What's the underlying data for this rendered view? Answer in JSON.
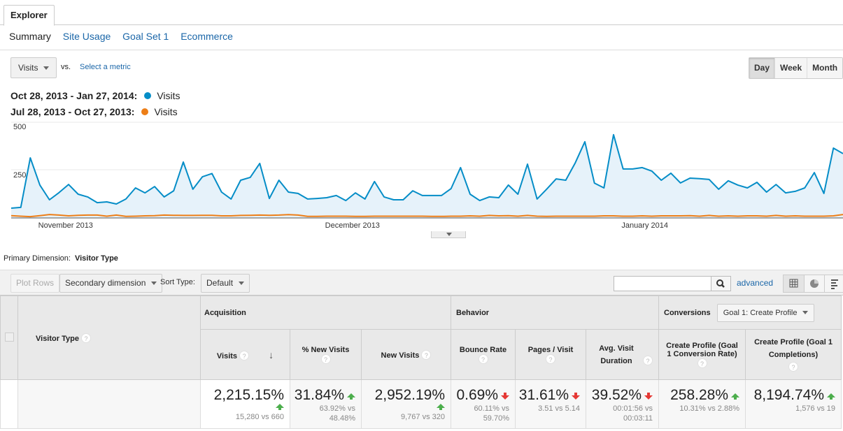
{
  "tabs": {
    "explorer": "Explorer"
  },
  "subtabs": [
    {
      "label": "Summary",
      "active": true
    },
    {
      "label": "Site Usage",
      "active": false
    },
    {
      "label": "Goal Set 1",
      "active": false
    },
    {
      "label": "Ecommerce",
      "active": false
    }
  ],
  "metric_selector": {
    "value": "Visits",
    "vs_label": "vs.",
    "select_metric": "Select a metric"
  },
  "period": {
    "options": [
      "Day",
      "Week",
      "Month"
    ],
    "selected": "Day"
  },
  "legend": [
    {
      "range": "Oct 28, 2013 - Jan 27, 2014:",
      "metric": "Visits",
      "color": "#058dc7"
    },
    {
      "range": "Jul 28, 2013 - Oct 27, 2013:",
      "metric": "Visits",
      "color": "#ed7e17"
    }
  ],
  "chart_data": {
    "type": "area",
    "title": "",
    "xlabel": "",
    "ylabel": "Visits",
    "ylim": [
      0,
      500
    ],
    "yticks": [
      250,
      500
    ],
    "xtick_labels": [
      {
        "label": "November 2013",
        "index": 4
      },
      {
        "label": "December 2013",
        "index": 34
      },
      {
        "label": "January 2014",
        "index": 65
      }
    ],
    "grid": true,
    "series": [
      {
        "name": "Visits (Oct 28, 2013 - Jan 27, 2014)",
        "color": "#058dc7",
        "fill": "#e6f2fa",
        "values": [
          51,
          55,
          314,
          172,
          95,
          132,
          175,
          124,
          110,
          80,
          84,
          73,
          99,
          157,
          131,
          164,
          110,
          142,
          292,
          150,
          215,
          232,
          135,
          99,
          197,
          212,
          285,
          102,
          197,
          135,
          128,
          99,
          102,
          106,
          117,
          91,
          131,
          99,
          190,
          110,
          95,
          95,
          142,
          117,
          117,
          117,
          153,
          263,
          124,
          91,
          110,
          106,
          172,
          124,
          281,
          99,
          150,
          204,
          197,
          288,
          398,
          182,
          157,
          435,
          256,
          256,
          263,
          245,
          197,
          234,
          183,
          208,
          205,
          201,
          150,
          194,
          172,
          157,
          186,
          135,
          175,
          131,
          139,
          157,
          237,
          128,
          365,
          336
        ]
      },
      {
        "name": "Visits (Jul 28, 2013 - Oct 27, 2013)",
        "color": "#ed7e17",
        "values": [
          12,
          9,
          7,
          12,
          18,
          15,
          11,
          14,
          15,
          15,
          9,
          15,
          8,
          9,
          11,
          12,
          15,
          14,
          13,
          13,
          14,
          14,
          11,
          11,
          13,
          14,
          15,
          14,
          15,
          17,
          15,
          8,
          8,
          9,
          9,
          9,
          8,
          8,
          9,
          9,
          9,
          9,
          9,
          9,
          8,
          8,
          9,
          9,
          11,
          9,
          13,
          11,
          12,
          9,
          13,
          9,
          8,
          9,
          9,
          9,
          9,
          9,
          11,
          11,
          9,
          9,
          11,
          9,
          11,
          11,
          11,
          12,
          9,
          13,
          9,
          11,
          9,
          11,
          11,
          9,
          13,
          9,
          11,
          9,
          9,
          9,
          11,
          18,
          15
        ]
      }
    ]
  },
  "primary_dimension": {
    "label": "Primary Dimension:",
    "value": "Visitor Type"
  },
  "toolbar": {
    "plot_rows": "Plot Rows",
    "secondary_dimension": "Secondary dimension",
    "sort_type_label": "Sort Type:",
    "sort_type_value": "Default",
    "search_value": "",
    "advanced": "advanced"
  },
  "table": {
    "dimension_header": "Visitor Type",
    "groups": {
      "acquisition": "Acquisition",
      "behavior": "Behavior",
      "conversions": "Conversions",
      "goal_select": "Goal 1: Create Profile"
    },
    "columns": [
      {
        "label": "Visits",
        "sorted": "desc"
      },
      {
        "label": "% New Visits"
      },
      {
        "label": "New Visits"
      },
      {
        "label": "Bounce Rate"
      },
      {
        "label": "Pages / Visit"
      },
      {
        "label": "Avg. Visit Duration"
      },
      {
        "label": "Create Profile (Goal 1 Conversion Rate)"
      },
      {
        "label": "Create Profile (Goal 1 Completions)"
      }
    ],
    "totals": [
      {
        "change": "2,215.15%",
        "direction": "up",
        "detail": "15,280 vs 660"
      },
      {
        "change": "31.84%",
        "direction": "up",
        "detail": "63.92% vs 48.48%"
      },
      {
        "change": "2,952.19%",
        "direction": "up",
        "detail": "9,767 vs 320"
      },
      {
        "change": "0.69%",
        "direction": "down",
        "detail": "60.11% vs 59.70%"
      },
      {
        "change": "31.61%",
        "direction": "down",
        "detail": "3.51 vs 5.14"
      },
      {
        "change": "39.52%",
        "direction": "down",
        "detail": "00:01:56 vs 00:03:11"
      },
      {
        "change": "258.28%",
        "direction": "up",
        "detail": "10.31% vs 2.88%"
      },
      {
        "change": "8,194.74%",
        "direction": "up",
        "detail": "1,576 vs 19"
      }
    ]
  }
}
